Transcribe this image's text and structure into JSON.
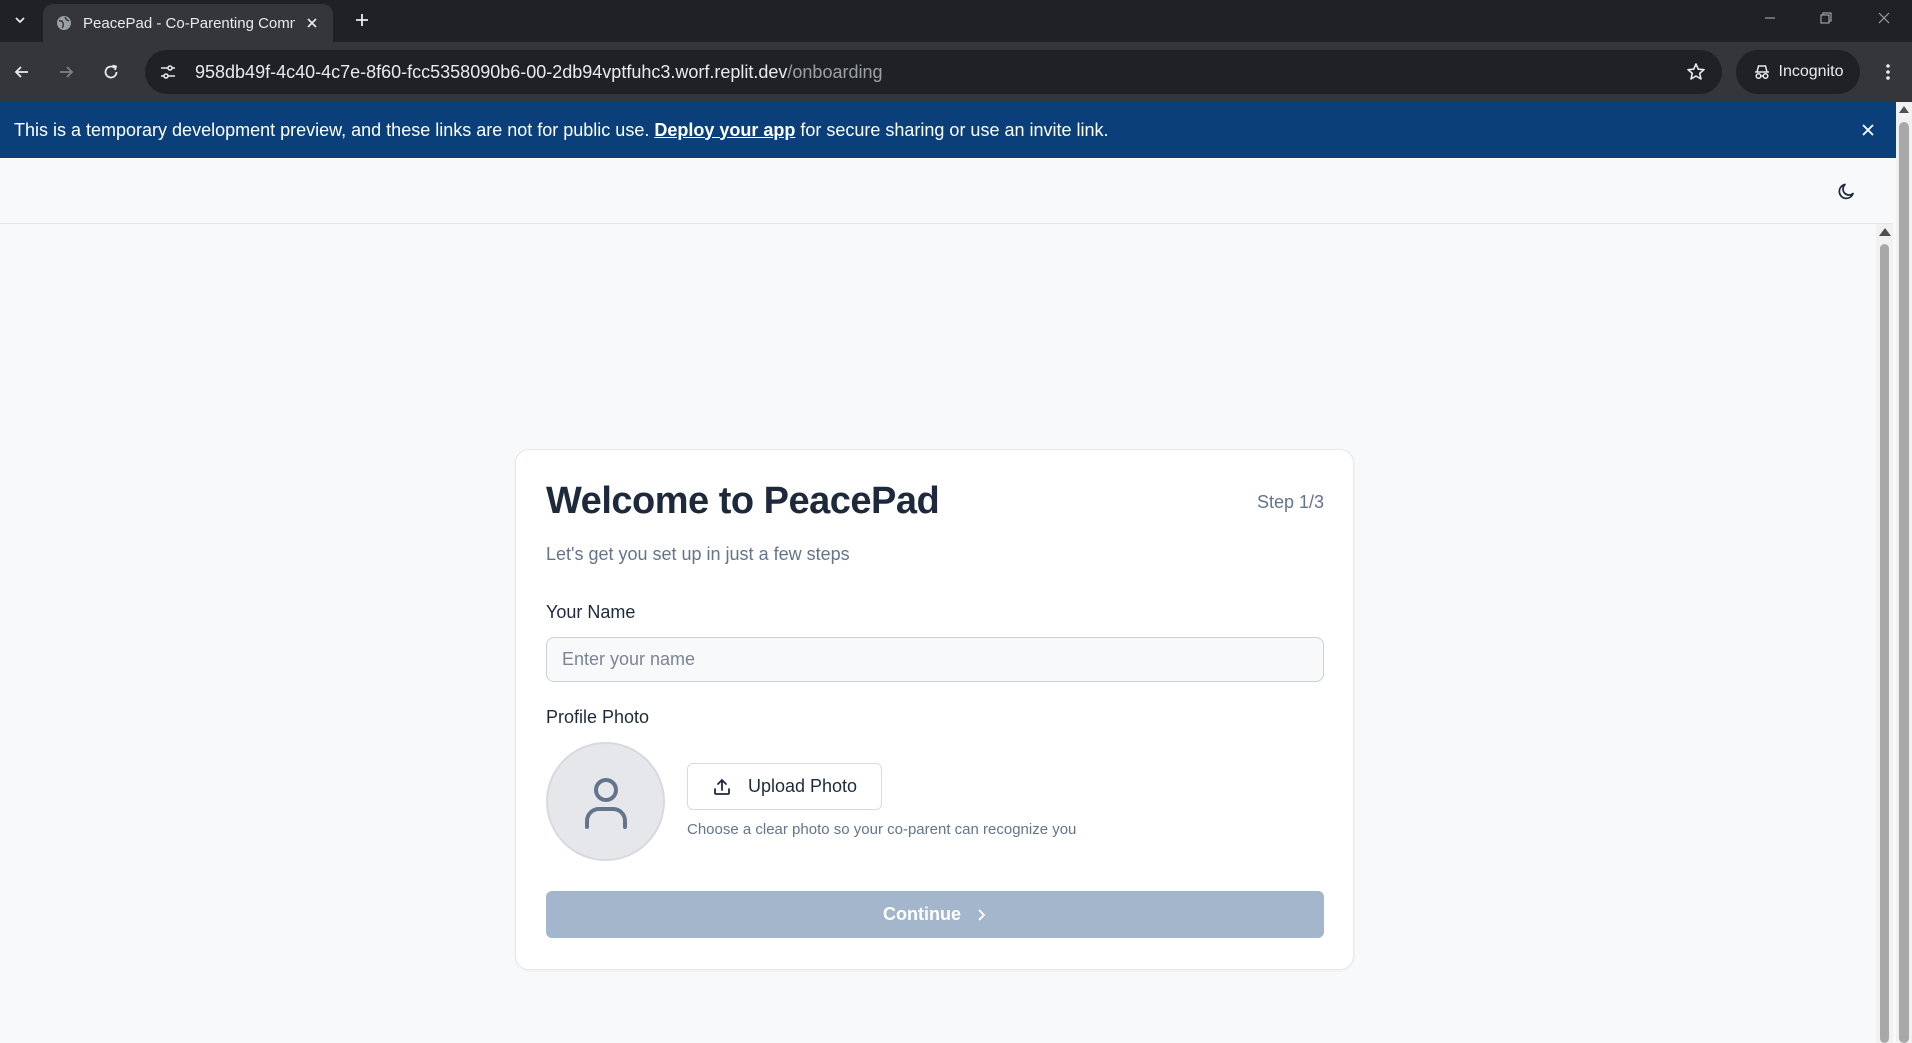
{
  "browser": {
    "tab_title": "PeacePad - Co-Parenting Comm",
    "url_host": "958db49f-4c40-4c7e-8f60-fcc5358090b6-00-2db94vptfuhc3.worf.replit.dev",
    "url_path": "/onboarding",
    "profile_label": "Incognito",
    "icons": [
      "tab-search-icon",
      "globe-icon",
      "close-icon",
      "plus-icon",
      "minimize-icon",
      "restore-icon",
      "back-icon",
      "forward-icon",
      "reload-icon",
      "site-info-icon",
      "star-icon",
      "incognito-icon",
      "more-vert-icon"
    ]
  },
  "banner": {
    "text_before": "This is a temporary development preview, and these links are not for public use.",
    "link_text": "Deploy your app",
    "text_after": "for secure sharing or use an invite link.",
    "background": "#0b3f7a"
  },
  "header": {
    "theme_icon": "moon-icon"
  },
  "onboarding": {
    "title": "Welcome to PeacePad",
    "step": "Step 1/3",
    "subtitle": "Let's get you set up in just a few steps",
    "name_label": "Your Name",
    "name_value": "",
    "name_placeholder": "Enter your name",
    "photo_label": "Profile Photo",
    "upload_label": "Upload Photo",
    "photo_hint": "Choose a clear photo so your co-parent can recognize you",
    "continue_label": "Continue",
    "continue_color": "#a3b6cb"
  }
}
